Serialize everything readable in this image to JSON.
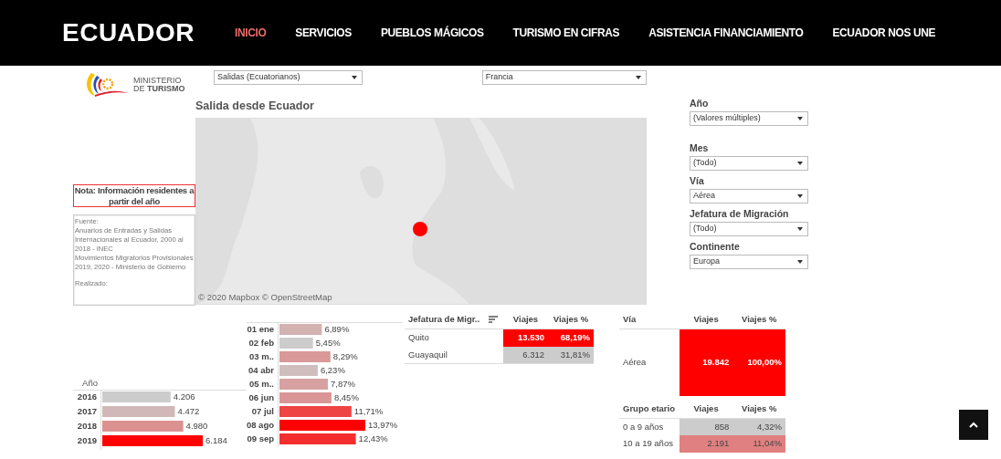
{
  "navbar": {
    "brand": "ECUADOR",
    "items": [
      {
        "label": "INICIO",
        "selected": true
      },
      {
        "label": "SERVICIOS",
        "selected": false
      },
      {
        "label": "PUEBLOS MÁGICOS",
        "selected": false
      },
      {
        "label": "TURISMO EN CIFRAS",
        "selected": false
      },
      {
        "label": "ASISTENCIA FINANCIAMIENTO",
        "selected": false
      },
      {
        "label": "ECUADOR NOS UNE",
        "selected": false
      }
    ]
  },
  "ministry_logo": {
    "lines": [
      "MINISTERIO",
      "DE **TURISMO**"
    ]
  },
  "top_dropdowns": [
    {
      "value": "Salidas (Ecuatorianos)"
    },
    {
      "value": "Francia"
    }
  ],
  "note": "Nota: Información residentes a partir del año",
  "source": [
    "Fuente:",
    "Anuarios de Entradas y Salidas Internacionales al Ecuador, 2000 al 2018 - INEC",
    "Movimientos Migratorios Provisionales 2019, 2020 - Ministerio de Gobierno",
    "Realizado:"
  ],
  "map": {
    "title": "Salida desde Ecuador",
    "attribution": "© 2020 Mapbox © OpenStreetMap"
  },
  "filters": [
    {
      "label": "Año",
      "value": "(Valores múltiples)"
    },
    {
      "label": "Mes",
      "value": "(Todo)"
    },
    {
      "label": "Vía",
      "value": "Aérea"
    },
    {
      "label": "Jefatura de Migración",
      "value": "(Todo)"
    },
    {
      "label": "Continente",
      "value": "Europa"
    }
  ],
  "year_chart": {
    "chart_data": {
      "type": "bar",
      "orientation": "horizontal",
      "xlabel": "Año",
      "categories": [
        "2016",
        "2017",
        "2018",
        "2019"
      ],
      "values": [
        4206,
        4472,
        4980,
        6184
      ],
      "value_labels": [
        "4.206",
        "4.472",
        "4.980",
        "6.184"
      ]
    }
  },
  "month_chart": {
    "chart_data": {
      "type": "bar",
      "orientation": "horizontal",
      "categories": [
        "01 ene",
        "02 feb",
        "03 m..",
        "04 abr",
        "05 m..",
        "06 jun",
        "07 jul",
        "08 ago",
        "09 sep"
      ],
      "values": [
        6.89,
        5.45,
        8.29,
        6.23,
        7.87,
        8.45,
        11.71,
        13.97,
        12.43
      ],
      "value_labels": [
        "6,89%",
        "5,45%",
        "8,29%",
        "6,23%",
        "7,87%",
        "8,45%",
        "11,71%",
        "13,97%",
        "12,43%"
      ]
    }
  },
  "jefatura_table": {
    "columns": [
      "Jefatura de Migr..",
      "Viajes",
      "Viajes %"
    ],
    "rows": [
      {
        "cells": [
          "Quito",
          "13.530",
          "68,19%"
        ],
        "color": "#ff0000"
      },
      {
        "cells": [
          "Guayaquil",
          "6.312",
          "31,81%"
        ],
        "color": "#cccccc"
      }
    ]
  },
  "via_table": {
    "columns": [
      "Vía",
      "Viajes",
      "Viajes %"
    ],
    "rows": [
      {
        "cells": [
          "Aérea",
          "19.842",
          "100,00%"
        ],
        "color": "#ff0000"
      }
    ]
  },
  "age_table": {
    "columns": [
      "Grupo etario",
      "Viajes",
      "Viajes %"
    ],
    "rows": [
      {
        "cells": [
          "0 a 9 años",
          "858",
          "4,32%"
        ],
        "color": "#cccccc"
      },
      {
        "cells": [
          "10 a 19 años",
          "2.191",
          "11,04%"
        ],
        "color": "#e08080"
      }
    ]
  }
}
